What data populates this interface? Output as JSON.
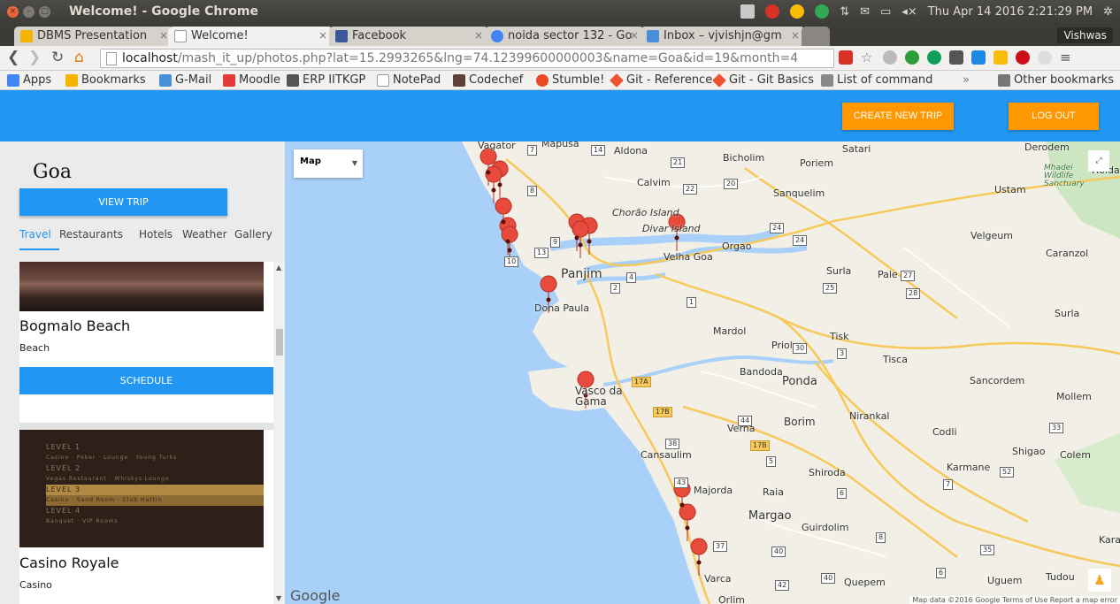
{
  "os": {
    "window_title": "Welcome! - Google Chrome",
    "clock": "Thu Apr 14 2016 2:21:29 PM"
  },
  "browser": {
    "tabs": [
      {
        "label": "DBMS Presentation",
        "favicon_color": "#f4b400"
      },
      {
        "label": "Welcome!",
        "favicon_color": "#ffffff"
      },
      {
        "label": "Facebook",
        "favicon_color": "#3b5998"
      },
      {
        "label": "noida sector 132 - Go",
        "favicon_color": "#4285f4"
      },
      {
        "label": "Inbox – vjvishjn@gm",
        "favicon_color": "#4a90d9"
      }
    ],
    "profile": "Vishwas",
    "url_host": "localhost",
    "url_rest": "/mash_it_up/photos.php?lat=15.2993265&lng=74.12399600000003&name=Goa&id=19&month=4",
    "bookmarks": [
      {
        "label": "Apps",
        "color": "#4285f4"
      },
      {
        "label": "Bookmarks",
        "color": "#f4b400"
      },
      {
        "label": "G-Mail",
        "color": "#4a90d9"
      },
      {
        "label": "Moodle",
        "color": "#e53935"
      },
      {
        "label": "ERP IITKGP",
        "color": "#555555"
      },
      {
        "label": "NotePad",
        "color": "#dddddd"
      },
      {
        "label": "Codechef",
        "color": "#5d4037"
      },
      {
        "label": "Stumble!",
        "color": "#eb4924"
      },
      {
        "label": "Git - Reference",
        "color": "#f05133"
      },
      {
        "label": "Git - Git Basics",
        "color": "#f05133"
      },
      {
        "label": "List of command",
        "color": "#888888"
      }
    ],
    "other_bookmarks": "Other bookmarks"
  },
  "header": {
    "create_trip": "CREATE NEW TRIP",
    "logout": "LOG OUT",
    "color": "#2196f3",
    "accent": "#ff9800"
  },
  "sidebar": {
    "city": "Goa",
    "view_trip": "VIEW TRIP",
    "tabs": [
      "Travel",
      "Restaurants",
      "Hotels",
      "Weather",
      "Gallery"
    ],
    "places": [
      {
        "name": "Bogmalo Beach",
        "category": "Beach",
        "action": "SCHEDULE"
      },
      {
        "name": "Casino Royale",
        "category": "Casino"
      }
    ],
    "casino_sign": [
      "LEVEL 1",
      "Casino · Poker · Lounge · Young Turks",
      "LEVEL 2",
      "Vegas Restaurant · Whiskys Lounge",
      "LEVEL 3",
      "Casino · Sand Room · Club Hattin",
      "LEVEL 4",
      "Banquet · VIP Rooms"
    ]
  },
  "map": {
    "type_label": "Map",
    "places": [
      "Vagator",
      "Mapusa",
      "Aldona",
      "Bicholim",
      "Poriem",
      "Satari",
      "Derodem",
      "Mhadei Wildlife Sanctuary",
      "Hoida",
      "Ustam",
      "Calvim",
      "Sanquelim",
      "Chorão Island",
      "Divar Island",
      "Velgeum",
      "Orgao",
      "Caranzol",
      "Velha Goa",
      "Surla",
      "Pale",
      "Panjim",
      "Dona Paula",
      "Surla",
      "Mardol",
      "Priol",
      "Tisk",
      "Tisca",
      "Bandoda",
      "Ponda",
      "Sancordem",
      "Mollem",
      "Vasco da Gama",
      "Nirankal",
      "Codli",
      "Verna",
      "Borim",
      "Cansaulim",
      "Shiroda",
      "Shigao",
      "Colem",
      "Karmane",
      "Majorda",
      "Raia",
      "Margao",
      "Guirdolim",
      "Kara",
      "Varca",
      "Quepem",
      "Uguem",
      "Tudou",
      "Orlim"
    ],
    "roads": [
      "7",
      "14",
      "21",
      "20",
      "8",
      "22",
      "24",
      "24",
      "9",
      "13",
      "10",
      "4",
      "2",
      "1",
      "27",
      "25",
      "28",
      "30",
      "3",
      "17A",
      "17B",
      "44",
      "17B",
      "38",
      "5",
      "43",
      "6",
      "7",
      "52",
      "33",
      "37",
      "40",
      "8",
      "35",
      "42",
      "40",
      "6"
    ],
    "google": "Google",
    "attribution": "Map data ©2016 Google   Terms of Use   Report a map error",
    "pin_color": "#e84a3c",
    "water_color": "#a9d0f8",
    "land_color": "#f2efe6"
  }
}
